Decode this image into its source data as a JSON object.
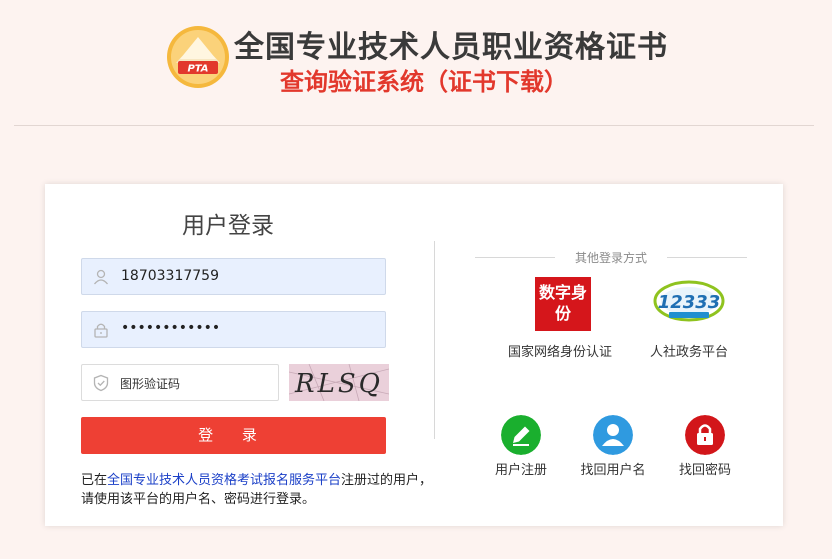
{
  "header": {
    "logo_text": "PTA",
    "title": "全国专业技术人员职业资格证书",
    "subtitle": "查询验证系统（证书下载）"
  },
  "login": {
    "title": "用户登录",
    "username_value": "18703317759",
    "password_value": "••••••••••••",
    "captcha_placeholder": "图形验证码",
    "captcha_text": "RLSQ",
    "submit_label": "登 录",
    "note_prefix": "已在",
    "note_link": "全国专业技术人员资格考试报名服务平台",
    "note_suffix": "注册过的用户，请使用该平台的用户名、密码进行登录。"
  },
  "other_login": {
    "title": "其他登录方式",
    "providers": [
      {
        "label": "国家网络身份认证",
        "icon": "digital-id-icon",
        "icon_text": "数字身份"
      },
      {
        "label": "人社政务平台",
        "icon": "12333-icon",
        "icon_text": "12333"
      }
    ]
  },
  "actions": [
    {
      "label": "用户注册",
      "icon": "edit-icon",
      "color": "#1aaf2e"
    },
    {
      "label": "找回用户名",
      "icon": "user-icon",
      "color": "#2f9ae0"
    },
    {
      "label": "找回密码",
      "icon": "lock-icon",
      "color": "#d2161a"
    }
  ],
  "colors": {
    "accent": "#ee4034",
    "title_red": "#e2382c",
    "link": "#1a3fc7",
    "background": "#fdf3f0"
  }
}
